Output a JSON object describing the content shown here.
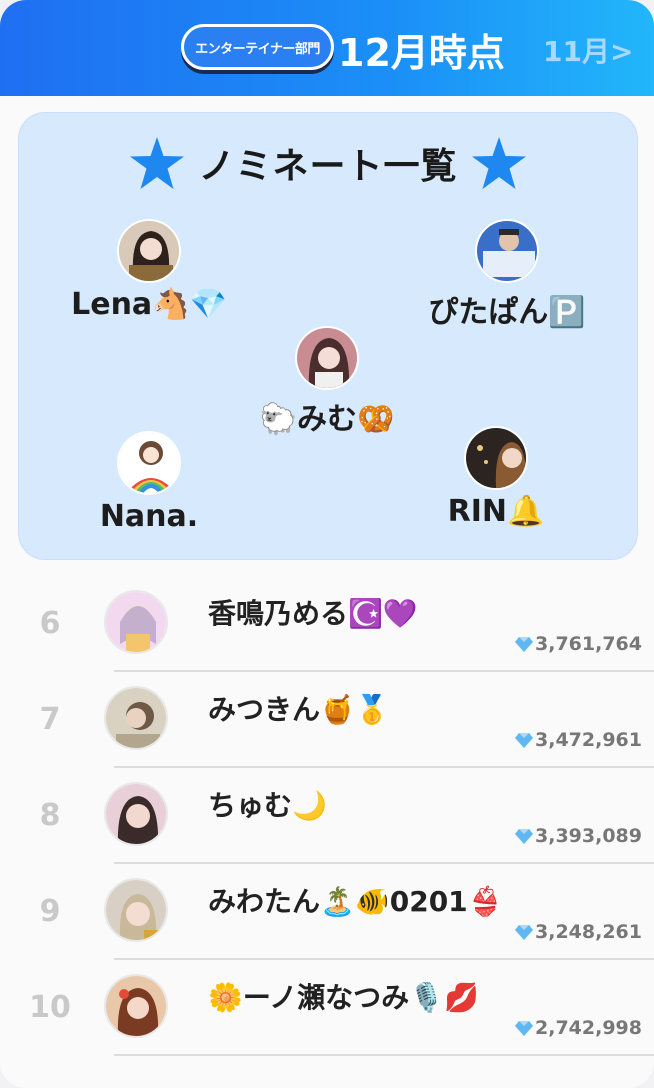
{
  "header": {
    "category_label": "エンターテイナー部門",
    "current_month": "12月時点",
    "prev_month_link": "11月>"
  },
  "nominees_panel": {
    "title": "ノミネート一覧",
    "nominees": [
      {
        "name": "Lena🐴💎"
      },
      {
        "name": "ぴたぱん🅿️"
      },
      {
        "name": "🐑みむ🥨"
      },
      {
        "name": "Nana."
      },
      {
        "name": "RIN🔔"
      }
    ]
  },
  "ranking": [
    {
      "rank": "6",
      "name": "香鳴乃める☪️💜",
      "score": "3,761,764"
    },
    {
      "rank": "7",
      "name": "みつきん🍯🥇",
      "score": "3,472,961"
    },
    {
      "rank": "8",
      "name": "ちゅむ🌙",
      "score": "3,393,089"
    },
    {
      "rank": "9",
      "name": "みわたん🏝️🐠0201👙",
      "score": "3,248,261"
    },
    {
      "rank": "10",
      "name": "🌼ーノ瀬なつみ🎙️💋",
      "score": "2,742,998"
    }
  ],
  "colors": {
    "header_start": "#1f6ff2",
    "header_end": "#22b6fb",
    "panel_bg": "#d6e9fd",
    "star": "#1e88f0",
    "gem": "#5fb8f2"
  },
  "icons": {
    "star": "star-icon",
    "gem": "diamond-gem-icon"
  }
}
